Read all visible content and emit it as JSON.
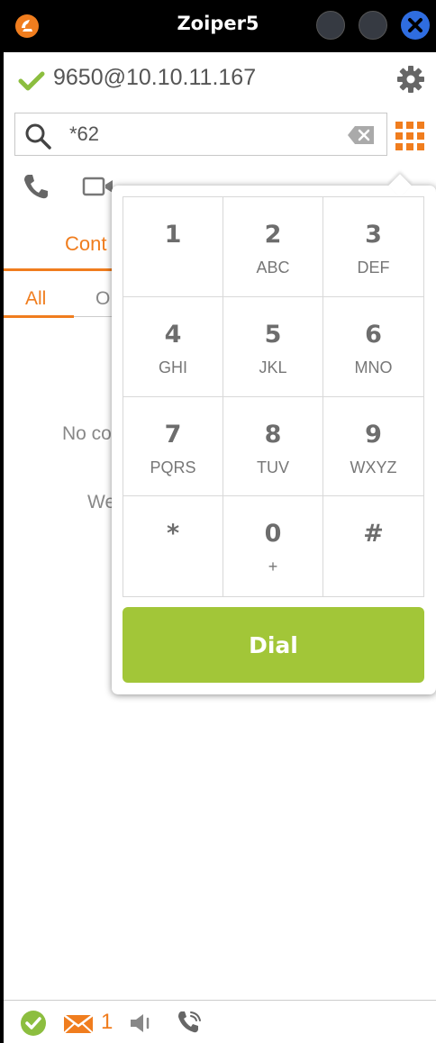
{
  "window": {
    "title": "Zoiper5",
    "logo_icon": "zoiper-logo-icon",
    "accent": "#f07d1e"
  },
  "account": {
    "status_icon": "check-icon",
    "status_color": "#8cbe3f",
    "id": "9650@10.10.11.167",
    "settings_icon": "gear-icon"
  },
  "search": {
    "value": "*62",
    "icon": "search-icon",
    "clear_icon": "backspace-icon",
    "keypad_icon": "keypad-grid-icon"
  },
  "actions": {
    "call_icon": "phone-icon",
    "video_icon": "video-camera-icon"
  },
  "tabs": {
    "contacts": "Cont",
    "sub_all": "All",
    "sub_other": "O"
  },
  "list": {
    "empty_text": "No co",
    "welcome_text": "We"
  },
  "dialpad": {
    "keys": [
      {
        "digit": "1",
        "letters": ""
      },
      {
        "digit": "2",
        "letters": "ABC"
      },
      {
        "digit": "3",
        "letters": "DEF"
      },
      {
        "digit": "4",
        "letters": "GHI"
      },
      {
        "digit": "5",
        "letters": "JKL"
      },
      {
        "digit": "6",
        "letters": "MNO"
      },
      {
        "digit": "7",
        "letters": "PQRS"
      },
      {
        "digit": "8",
        "letters": "TUV"
      },
      {
        "digit": "9",
        "letters": "WXYZ"
      },
      {
        "digit": "*",
        "letters": ""
      },
      {
        "digit": "0",
        "letters": "+"
      },
      {
        "digit": "#",
        "letters": ""
      }
    ],
    "dial_label": "Dial",
    "dial_color": "#a2c638"
  },
  "statusbar": {
    "status_icon": "check-circle-icon",
    "mail_icon": "mail-icon",
    "mail_count": "1",
    "speaker_icon": "speaker-icon",
    "call_icon": "handset-icon"
  }
}
